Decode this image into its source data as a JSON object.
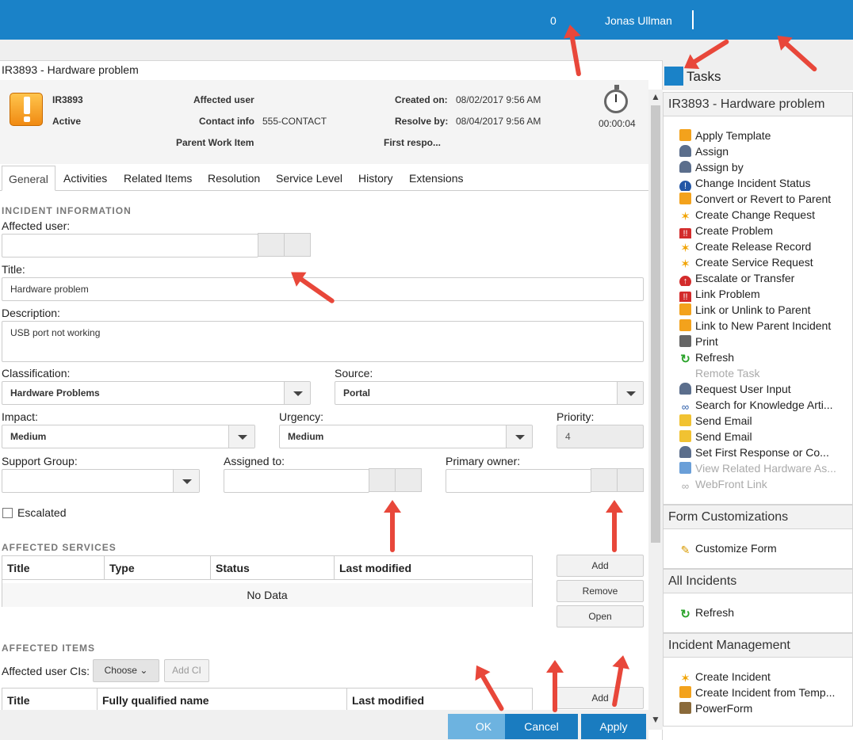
{
  "topbar": {
    "notification_count": "0",
    "user_name": "Jonas Ullman"
  },
  "form": {
    "title": "IR3893 - Hardware problem",
    "header": {
      "id": "IR3893",
      "status": "Active",
      "affected_user_label": "Affected user",
      "contact_info_label": "Contact info",
      "contact_info_value": "555-CONTACT",
      "parent_work_item_label": "Parent Work Item",
      "created_on_label": "Created on:",
      "created_on_value": "08/02/2017 9:56 AM",
      "resolve_by_label": "Resolve by:",
      "resolve_by_value": "08/04/2017 9:56 AM",
      "first_response_label": "First respo...",
      "timer": "00:00:04"
    },
    "tabs": [
      "General",
      "Activities",
      "Related Items",
      "Resolution",
      "Service Level",
      "History",
      "Extensions"
    ],
    "incident_info_heading": "INCIDENT INFORMATION",
    "affected_user_label": "Affected user:",
    "affected_user_value": "",
    "title_label": "Title:",
    "title_value": "Hardware problem",
    "description_label": "Description:",
    "description_value": "USB port not working",
    "classification_label": "Classification:",
    "classification_value": "Hardware Problems",
    "source_label": "Source:",
    "source_value": "Portal",
    "impact_label": "Impact:",
    "impact_value": "Medium",
    "urgency_label": "Urgency:",
    "urgency_value": "Medium",
    "priority_label": "Priority:",
    "priority_value": "4",
    "support_group_label": "Support Group:",
    "support_group_value": "",
    "assigned_to_label": "Assigned to:",
    "assigned_to_value": "",
    "primary_owner_label": "Primary owner:",
    "primary_owner_value": "",
    "escalated_label": "Escalated",
    "affected_services": {
      "heading": "AFFECTED SERVICES",
      "columns": [
        "Title",
        "Type",
        "Status",
        "Last modified"
      ],
      "empty_text": "No Data",
      "add_label": "Add",
      "remove_label": "Remove",
      "open_label": "Open"
    },
    "affected_items": {
      "heading": "AFFECTED ITEMS",
      "user_cis_label": "Affected user CIs:",
      "choose_label": "Choose",
      "add_ci_label": "Add CI",
      "columns": [
        "Title",
        "Fully qualified name",
        "Last modified"
      ],
      "add_label": "Add"
    },
    "footer": {
      "ok_label": "OK",
      "cancel_label": "Cancel",
      "apply_label": "Apply"
    }
  },
  "tasks_panel": {
    "title": "Tasks",
    "sections": [
      {
        "heading": "IR3893 - Hardware problem",
        "items": [
          {
            "label": "Apply Template",
            "icon": "template-icon",
            "enabled": true
          },
          {
            "label": "Assign",
            "icon": "person-icon",
            "enabled": true
          },
          {
            "label": "Assign by",
            "icon": "person-icon",
            "enabled": true
          },
          {
            "label": "Change Incident Status",
            "icon": "info-icon",
            "enabled": true
          },
          {
            "label": "Convert or Revert to Parent",
            "icon": "template-icon",
            "enabled": true
          },
          {
            "label": "Create Change Request",
            "icon": "star-icon",
            "enabled": true
          },
          {
            "label": "Create Problem",
            "icon": "problem-icon",
            "enabled": true
          },
          {
            "label": "Create Release Record",
            "icon": "star-icon",
            "enabled": true
          },
          {
            "label": "Create Service Request",
            "icon": "star-icon",
            "enabled": true
          },
          {
            "label": "Escalate or Transfer",
            "icon": "escalate-icon",
            "enabled": true
          },
          {
            "label": "Link Problem",
            "icon": "problem-icon",
            "enabled": true
          },
          {
            "label": "Link or Unlink to Parent",
            "icon": "template-icon",
            "enabled": true
          },
          {
            "label": "Link to New Parent Incident",
            "icon": "template-icon",
            "enabled": true
          },
          {
            "label": "Print",
            "icon": "print-icon",
            "enabled": true
          },
          {
            "label": "Refresh",
            "icon": "refresh-icon",
            "enabled": true
          },
          {
            "label": "Remote Task",
            "icon": "none",
            "enabled": false
          },
          {
            "label": "Request User Input",
            "icon": "person-icon",
            "enabled": true
          },
          {
            "label": "Search for Knowledge Arti...",
            "icon": "link-icon",
            "enabled": true
          },
          {
            "label": "Send Email",
            "icon": "mail-icon",
            "enabled": true
          },
          {
            "label": "Send Email",
            "icon": "mail-icon",
            "enabled": true
          },
          {
            "label": "Set First Response or Co...",
            "icon": "person-icon",
            "enabled": true
          },
          {
            "label": "View Related Hardware As...",
            "icon": "computer-icon",
            "enabled": false
          },
          {
            "label": "WebFront Link",
            "icon": "link-icon",
            "enabled": false
          }
        ]
      },
      {
        "heading": "Form Customizations",
        "items": [
          {
            "label": "Customize Form",
            "icon": "pencil-icon",
            "enabled": true
          }
        ]
      },
      {
        "heading": "All Incidents",
        "items": [
          {
            "label": "Refresh",
            "icon": "refresh-icon",
            "enabled": true
          }
        ]
      },
      {
        "heading": "Incident Management",
        "items": [
          {
            "label": "Create Incident",
            "icon": "star-icon",
            "enabled": true
          },
          {
            "label": "Create Incident from Temp...",
            "icon": "template-icon",
            "enabled": true
          },
          {
            "label": "PowerForm",
            "icon": "form-icon",
            "enabled": true
          }
        ]
      }
    ]
  },
  "colors": {
    "accent": "#1a82c8",
    "annotation_arrow": "#e8473a",
    "ok_button": "#6db3e0",
    "button": "#1a7cc0"
  }
}
